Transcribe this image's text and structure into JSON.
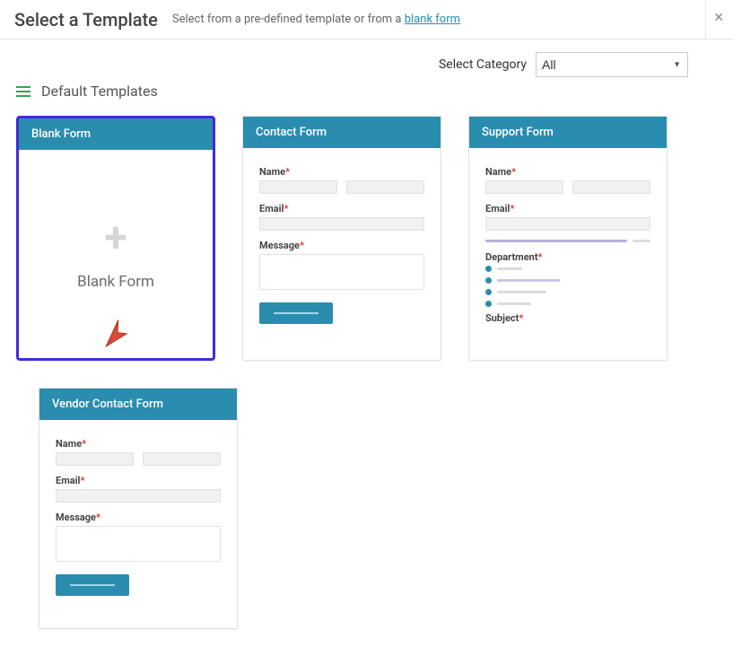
{
  "header": {
    "title": "Select a Template",
    "subtitle_prefix": "Select from a pre-defined template or from a ",
    "blank_form_link": "blank form"
  },
  "category": {
    "label": "Select Category",
    "selected": "All",
    "options": [
      "All"
    ]
  },
  "section": {
    "title": "Default Templates"
  },
  "templates": {
    "blank": {
      "title": "Blank Form",
      "body_label": "Blank Form"
    },
    "contact": {
      "title": "Contact Form",
      "fields": {
        "name": "Name",
        "email": "Email",
        "message": "Message"
      }
    },
    "support": {
      "title": "Support Form",
      "fields": {
        "name": "Name",
        "email": "Email",
        "department": "Department",
        "subject": "Subject"
      }
    },
    "vendor": {
      "title": "Vendor Contact Form",
      "fields": {
        "name": "Name",
        "email": "Email",
        "message": "Message"
      }
    }
  },
  "colors": {
    "accent": "#2a8db0",
    "selected_border": "#3d2ed6",
    "required": "#d33",
    "burger": "#2fa64f"
  }
}
